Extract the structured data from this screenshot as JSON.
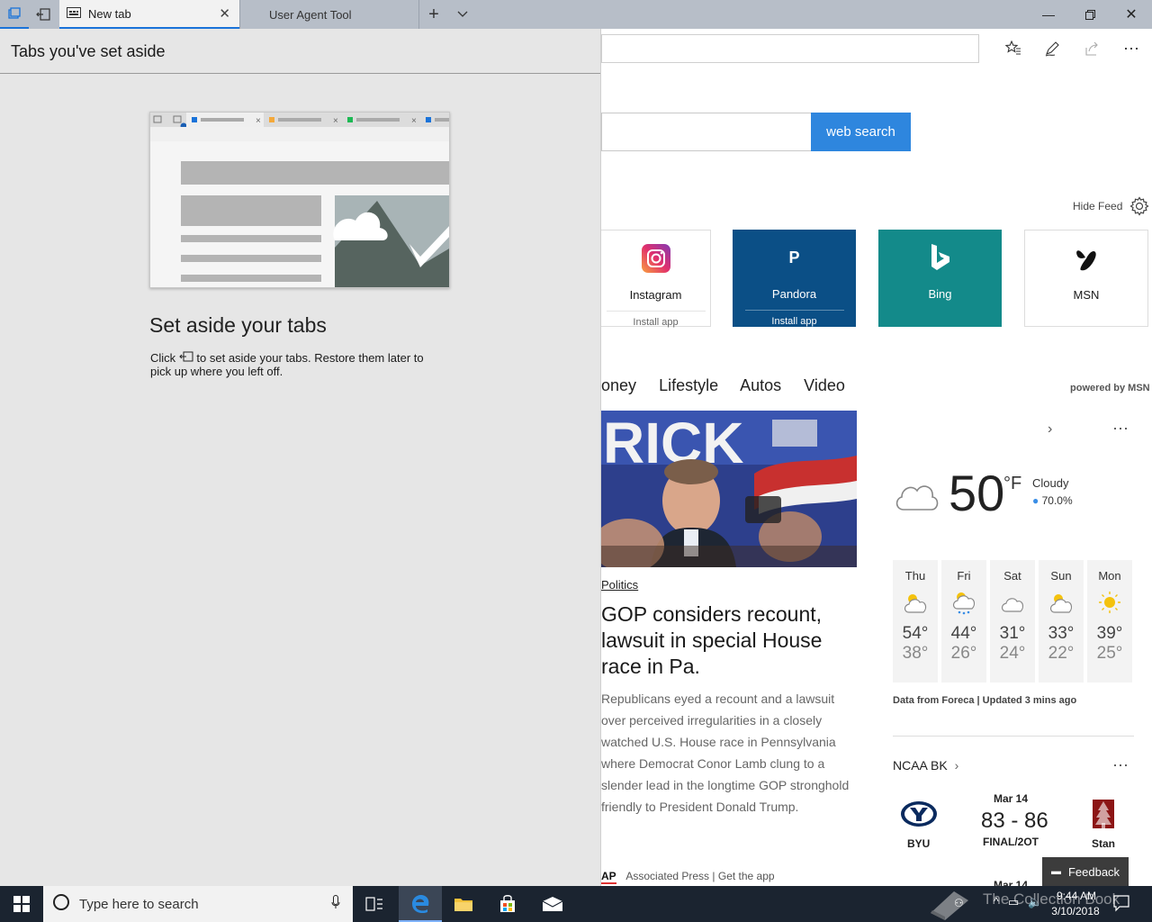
{
  "tabs": [
    {
      "label": "New tab"
    },
    {
      "label": "User Agent Tool"
    }
  ],
  "aside": {
    "header": "Tabs you've set aside",
    "title": "Set aside your tabs",
    "desc_before": "Click",
    "desc_after": "to set aside your tabs. Restore them later to pick up where you left off."
  },
  "search": {
    "button": "web search"
  },
  "feed": {
    "hide_label": "Hide Feed",
    "powered": "powered by MSN"
  },
  "tiles": [
    {
      "name": "Instagram",
      "sub": "Install app"
    },
    {
      "name": "Pandora",
      "sub": "Install app",
      "letter": "P"
    },
    {
      "name": "Bing",
      "sub": ""
    },
    {
      "name": "MSN",
      "sub": ""
    }
  ],
  "categories": [
    "oney",
    "Lifestyle",
    "Autos",
    "Video"
  ],
  "news": {
    "category": "Politics",
    "title": "GOP considers recount, lawsuit in special House race in Pa.",
    "body": "Republicans eyed a recount and a lawsuit over perceived irregularities in a closely watched U.S. House race in Pennsylvania where Democrat Conor Lamb clung to a slender lead in the longtime GOP stronghold friendly to President Donald Trump.",
    "source": "Associated Press",
    "get_app": "| Get the app",
    "ap": "AP",
    "sign_text": "RICK"
  },
  "weather": {
    "temp": "50",
    "unit": "°F",
    "condition": "Cloudy",
    "humidity": "70.0%",
    "forecast": [
      {
        "day": "Thu",
        "hi": "54°",
        "lo": "38°",
        "icon": "sun-cloud-icon"
      },
      {
        "day": "Fri",
        "hi": "44°",
        "lo": "26°",
        "icon": "rain-cloud-icon"
      },
      {
        "day": "Sat",
        "hi": "31°",
        "lo": "24°",
        "icon": "cloud-icon"
      },
      {
        "day": "Sun",
        "hi": "33°",
        "lo": "22°",
        "icon": "sun-cloud-icon"
      },
      {
        "day": "Mon",
        "hi": "39°",
        "lo": "25°",
        "icon": "sun-icon"
      }
    ],
    "source": "Data from Foreca | Updated 3 mins ago"
  },
  "sports": {
    "league": "NCAA BK",
    "date": "Mar 14",
    "score": "83 - 86",
    "status": "FINAL/2OT",
    "team1": "BYU",
    "team2": "Stan",
    "next_date": "Mar 14"
  },
  "feedback": "Feedback",
  "taskbar": {
    "search_placeholder": "Type here to search",
    "time": "9:44 AM",
    "date": "3/10/2018",
    "watermark": "The Collection Book"
  },
  "colors": {
    "accent": "#2e86de",
    "pandora": "#0b4f86",
    "bing": "#138a8a",
    "taskbar": "#1b2430"
  }
}
